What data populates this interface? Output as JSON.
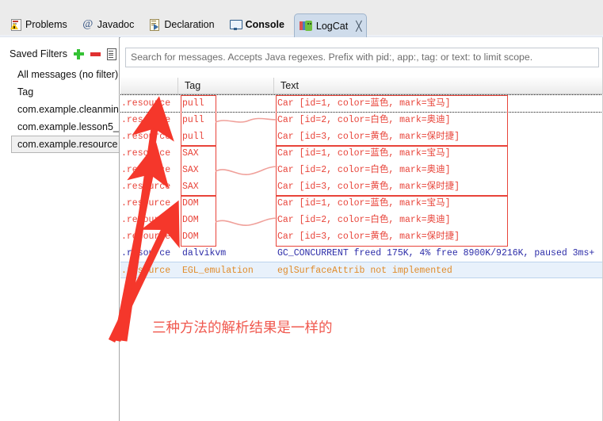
{
  "window": {
    "tabs": [
      {
        "label": "Problems",
        "icon": "problems-icon",
        "active": false,
        "bold": false
      },
      {
        "label": "Javadoc",
        "icon": "at-icon",
        "active": false,
        "bold": false
      },
      {
        "label": "Declaration",
        "icon": "declaration-icon",
        "active": false,
        "bold": false
      },
      {
        "label": "Console",
        "icon": "console-icon",
        "active": false,
        "bold": true
      },
      {
        "label": "LogCat",
        "icon": "logcat-icon",
        "active": true,
        "bold": false
      }
    ],
    "active_tab_close_glyph": "╳"
  },
  "sidebar": {
    "title": "Saved Filters",
    "actions": [
      {
        "name": "add-filter",
        "icon": "plus-icon",
        "color": "#35c235"
      },
      {
        "name": "remove-filter",
        "icon": "minus-icon",
        "color": "#e03131"
      },
      {
        "name": "edit-filter",
        "icon": "edit-icon",
        "color": "#555555"
      }
    ],
    "items": [
      {
        "label": "All messages (no filter)",
        "selected": false
      },
      {
        "label": "Tag",
        "selected": false
      },
      {
        "label": "com.example.cleanmint",
        "selected": false
      },
      {
        "label": "com.example.lesson5_",
        "selected": false
      },
      {
        "label": "com.example.resource",
        "selected": true
      }
    ]
  },
  "search": {
    "value": "",
    "placeholder": "Search for messages. Accepts Java regexes. Prefix with pid:, app:, tag: or text: to limit scope."
  },
  "table": {
    "headers": [
      "",
      "Tag",
      "Text"
    ],
    "rows": [
      {
        "app": ".resource",
        "tag": "pull",
        "text": "Car [id=1, color=蓝色, mark=宝马]",
        "color": "red",
        "selected": false
      },
      {
        "app": ".resource",
        "tag": "pull",
        "text": "Car [id=2, color=白色, mark=奥迪]",
        "color": "red",
        "selected": false
      },
      {
        "app": ".resource",
        "tag": "pull",
        "text": "Car [id=3, color=黄色, mark=保时捷]",
        "color": "red",
        "selected": false
      },
      {
        "app": ".resource",
        "tag": "SAX",
        "text": "Car [id=1, color=蓝色, mark=宝马]",
        "color": "red",
        "selected": false
      },
      {
        "app": ".resource",
        "tag": "SAX",
        "text": "Car [id=2, color=白色, mark=奥迪]",
        "color": "red",
        "selected": false
      },
      {
        "app": ".resource",
        "tag": "SAX",
        "text": "Car [id=3, color=黄色, mark=保时捷]",
        "color": "red",
        "selected": false
      },
      {
        "app": ".resource",
        "tag": "DOM",
        "text": "Car [id=1, color=蓝色, mark=宝马]",
        "color": "red",
        "selected": false
      },
      {
        "app": ".resource",
        "tag": "DOM",
        "text": "Car [id=2, color=白色, mark=奥迪]",
        "color": "red",
        "selected": false
      },
      {
        "app": ".resource",
        "tag": "DOM",
        "text": "Car [id=3, color=黄色, mark=保时捷]",
        "color": "red",
        "selected": false
      },
      {
        "app": ".resource",
        "tag": "dalvikvm",
        "text": "GC_CONCURRENT freed 175K, 4% free 8900K/9216K, paused 3ms+",
        "color": "blue",
        "selected": false
      },
      {
        "app": ".resource",
        "tag": "EGL_emulation",
        "text": "eglSurfaceAttrib not implemented",
        "color": "orange",
        "selected": true
      }
    ]
  },
  "annotation": {
    "text": "三种方法的解析结果是一样的",
    "color": "#f0594f",
    "arrow_count": 3,
    "highlight_color": "#e8443a"
  }
}
